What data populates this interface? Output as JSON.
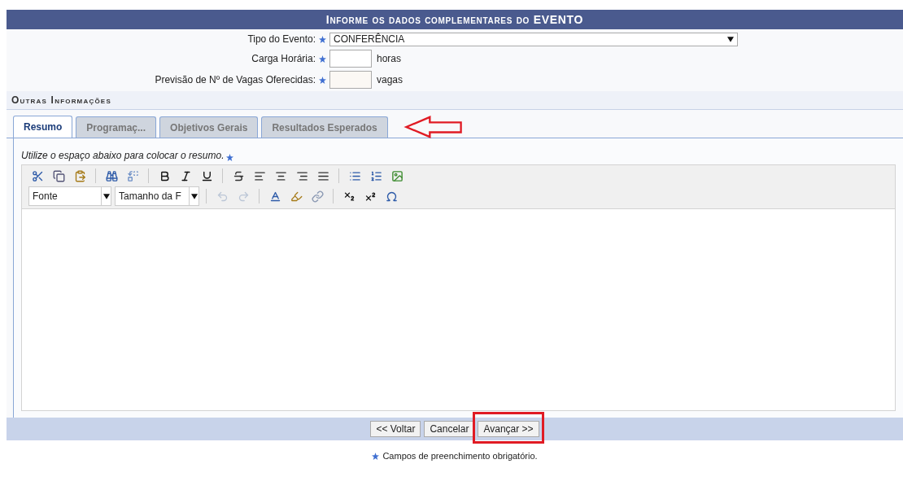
{
  "header": {
    "title": "Informe os dados complementares do EVENTO"
  },
  "fields": [
    {
      "label": "Tipo do Evento:",
      "kind": "select",
      "value": "CONFERÊNCIA",
      "required": true
    },
    {
      "label": "Carga Horária:",
      "kind": "input",
      "unit": "horas",
      "required": true
    },
    {
      "label": "Previsão de Nº de Vagas Oferecidas:",
      "kind": "input",
      "unit": "vagas",
      "required": true
    }
  ],
  "section": {
    "title": "Outras Informações"
  },
  "tabs": [
    {
      "label": "Resumo",
      "selected": true,
      "arrow": false
    },
    {
      "label": "Programaç...",
      "selected": false,
      "arrow": false
    },
    {
      "label": "Objetivos Gerais",
      "selected": false,
      "arrow": false
    },
    {
      "label": "Resultados Esperados",
      "selected": false,
      "arrow": true
    }
  ],
  "editor": {
    "instruction": "Utilize o espaço abaixo para colocar o resumo.",
    "font": "Fonte",
    "size": "Tamanho da F"
  },
  "buttons": [
    {
      "label": "<< Voltar",
      "highlighted": false
    },
    {
      "label": "Cancelar",
      "highlighted": false
    },
    {
      "label": "Avançar >>",
      "highlighted": true
    }
  ],
  "footnote": "Campos de preenchimento obrigatório."
}
